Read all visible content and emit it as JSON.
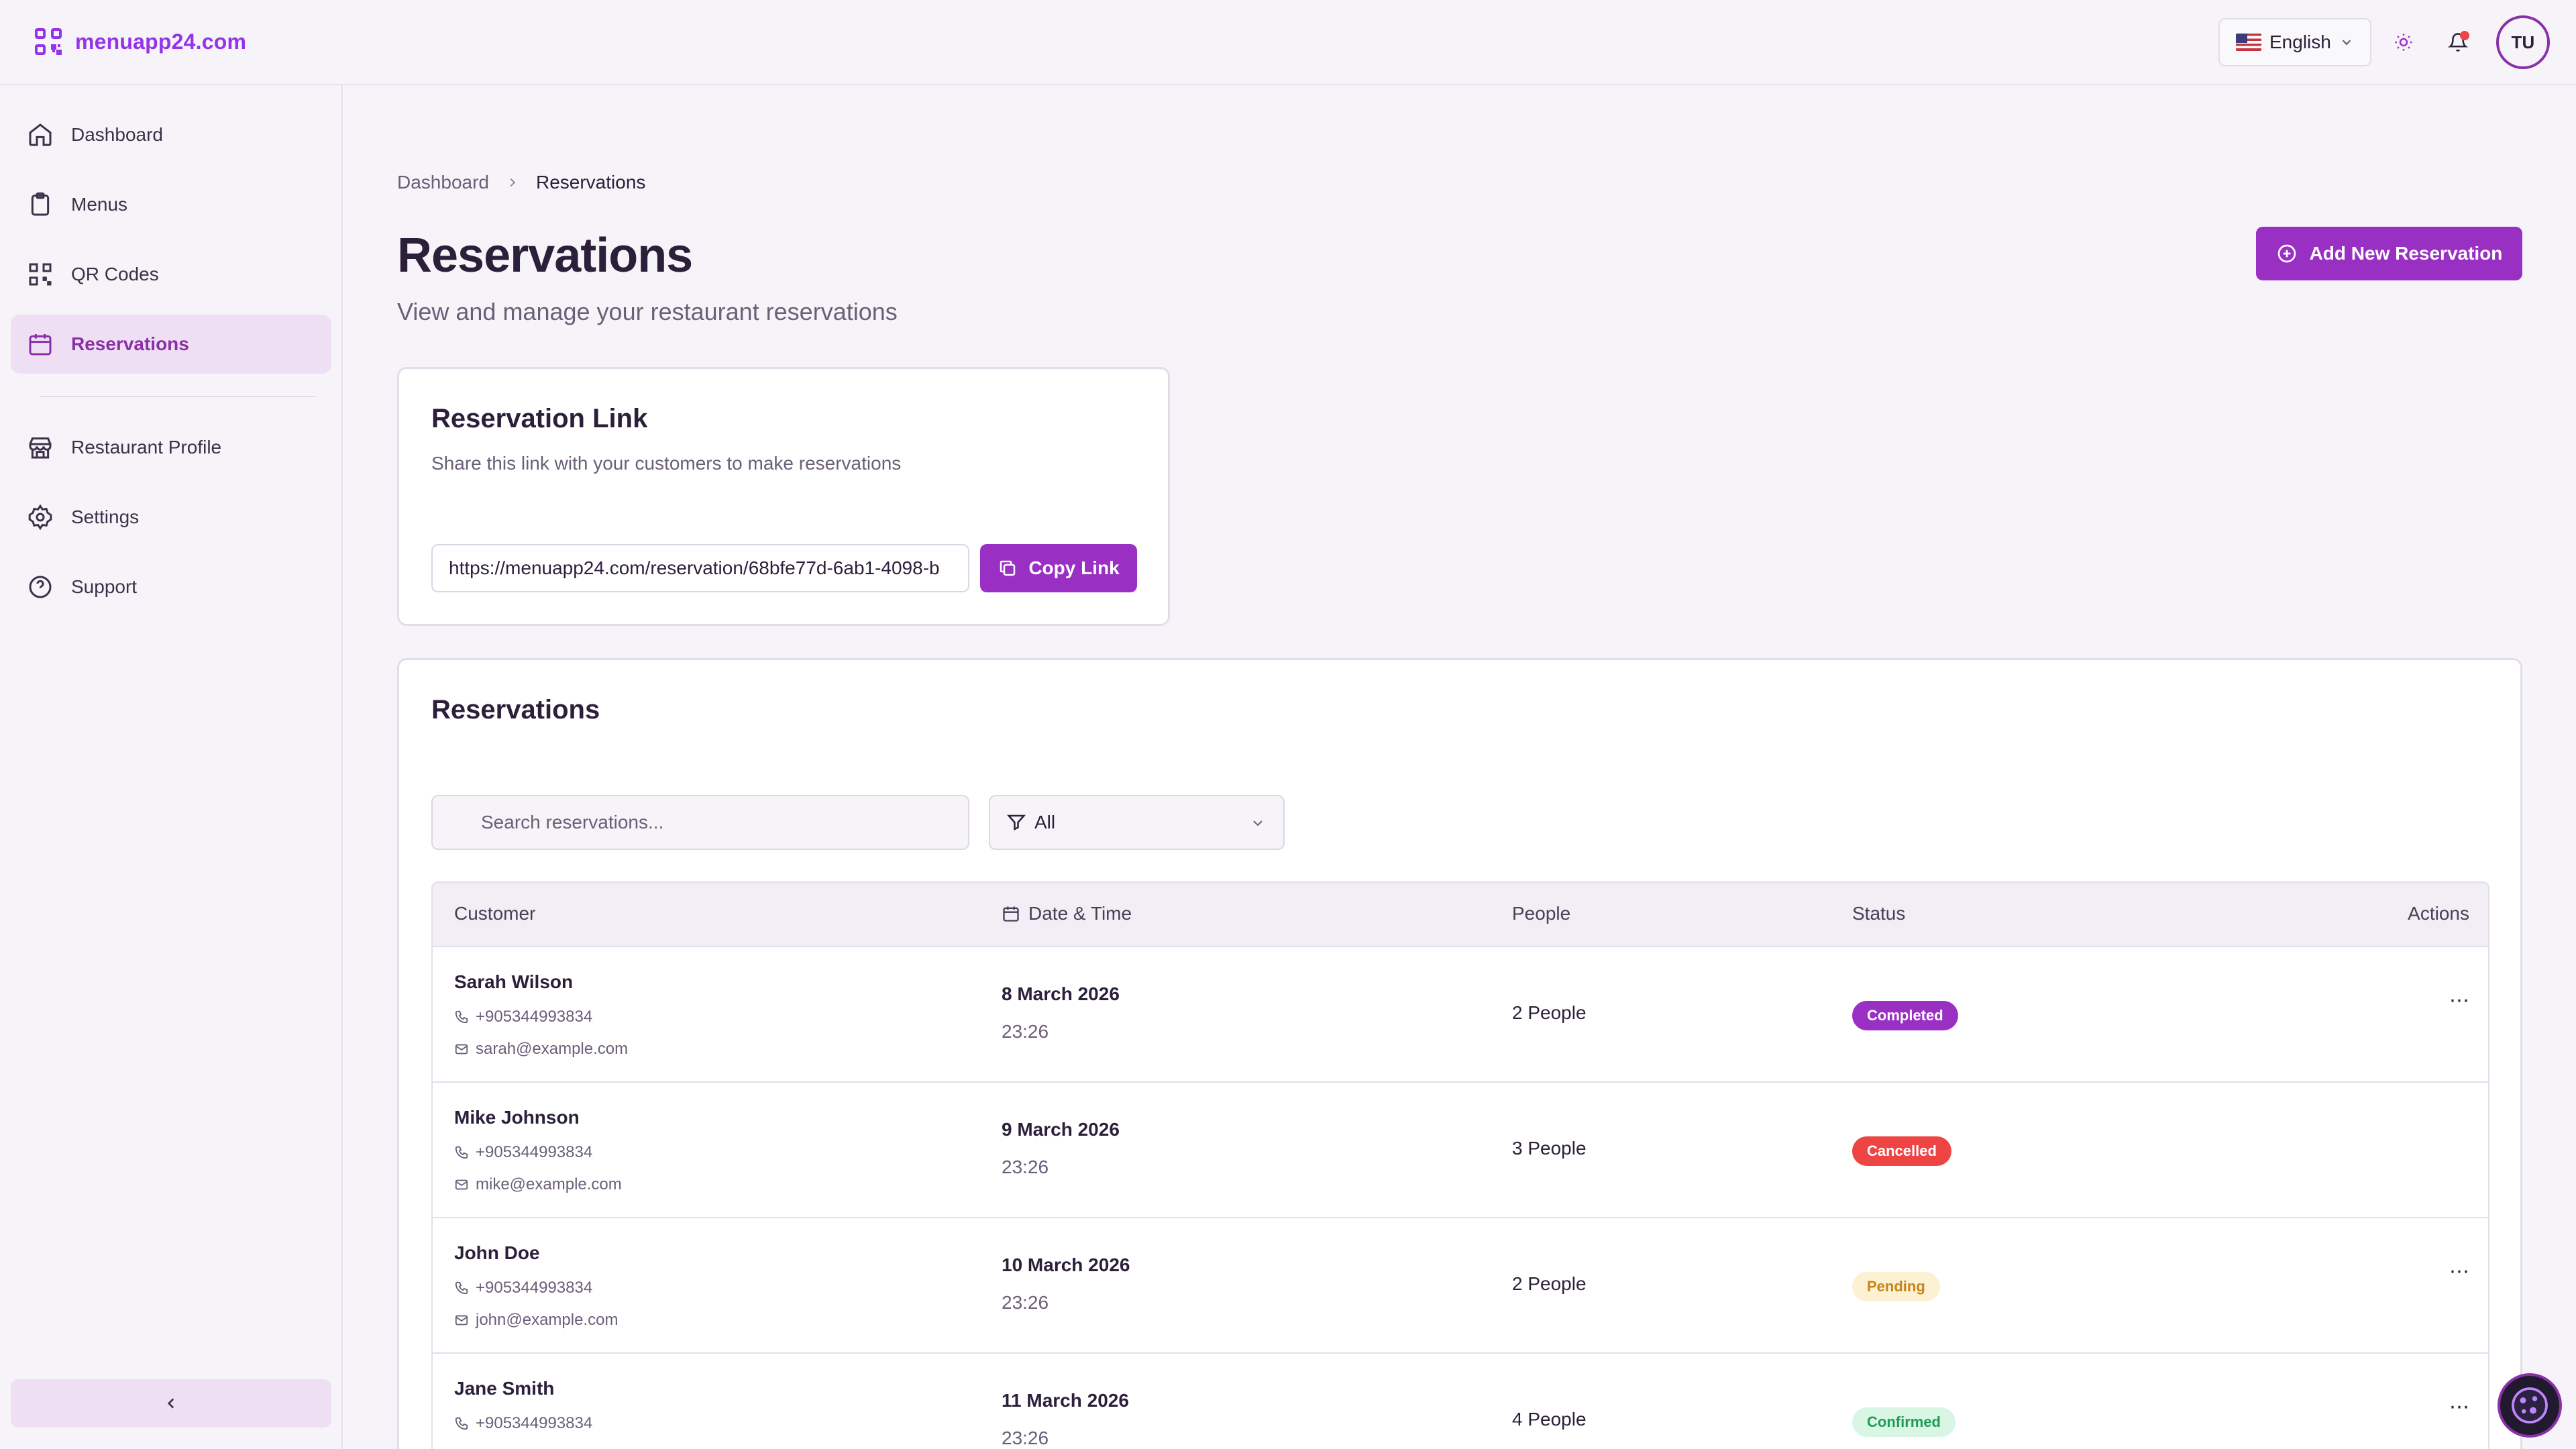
{
  "app": {
    "logo_text": "menuapp24.com"
  },
  "header": {
    "language": "English",
    "avatar_initials": "TU"
  },
  "sidebar": {
    "items": [
      {
        "label": "Dashboard"
      },
      {
        "label": "Menus"
      },
      {
        "label": "QR Codes"
      },
      {
        "label": "Reservations",
        "active": true
      },
      {
        "label": "Restaurant Profile"
      },
      {
        "label": "Settings"
      },
      {
        "label": "Support"
      }
    ]
  },
  "breadcrumb": {
    "parent": "Dashboard",
    "current": "Reservations"
  },
  "page": {
    "title": "Reservations",
    "subtitle": "View and manage your restaurant reservations",
    "add_button": "Add New Reservation"
  },
  "link_card": {
    "title": "Reservation Link",
    "description": "Share this link with your customers to make reservations",
    "url": "https://menuapp24.com/reservation/68bfe77d-6ab1-4098-b",
    "copy_button": "Copy Link"
  },
  "reservations": {
    "title": "Reservations",
    "search_placeholder": "Search reservations...",
    "filter_value": "All",
    "columns": {
      "customer": "Customer",
      "datetime": "Date & Time",
      "people": "People",
      "status": "Status",
      "actions": "Actions"
    },
    "rows": [
      {
        "name": "Sarah Wilson",
        "phone": "+905344993834",
        "email": "sarah@example.com",
        "date": "8 March 2026",
        "time": "23:26",
        "people": "2 People",
        "status": "Completed",
        "status_bg": "#9a2fc4",
        "status_fg": "#ffffff",
        "actions": "⋯"
      },
      {
        "name": "Mike Johnson",
        "phone": "+905344993834",
        "email": "mike@example.com",
        "date": "9 March 2026",
        "time": "23:26",
        "people": "3 People",
        "status": "Cancelled",
        "status_bg": "#ef4444",
        "status_fg": "#ffffff",
        "actions": ""
      },
      {
        "name": "John Doe",
        "phone": "+905344993834",
        "email": "john@example.com",
        "date": "10 March 2026",
        "time": "23:26",
        "people": "2 People",
        "status": "Pending",
        "status_bg": "#fdf1d3",
        "status_fg": "#c4851a",
        "actions": "⋯"
      },
      {
        "name": "Jane Smith",
        "phone": "+905344993834",
        "email": "",
        "date": "11 March 2026",
        "time": "23:26",
        "people": "4 People",
        "status": "Confirmed",
        "status_bg": "#d9f5e3",
        "status_fg": "#1f9d55",
        "actions": "⋯"
      }
    ]
  },
  "colors": {
    "accent": "#9a2fc4",
    "active_nav_bg": "#eedff4",
    "background": "#f6f4f8"
  }
}
